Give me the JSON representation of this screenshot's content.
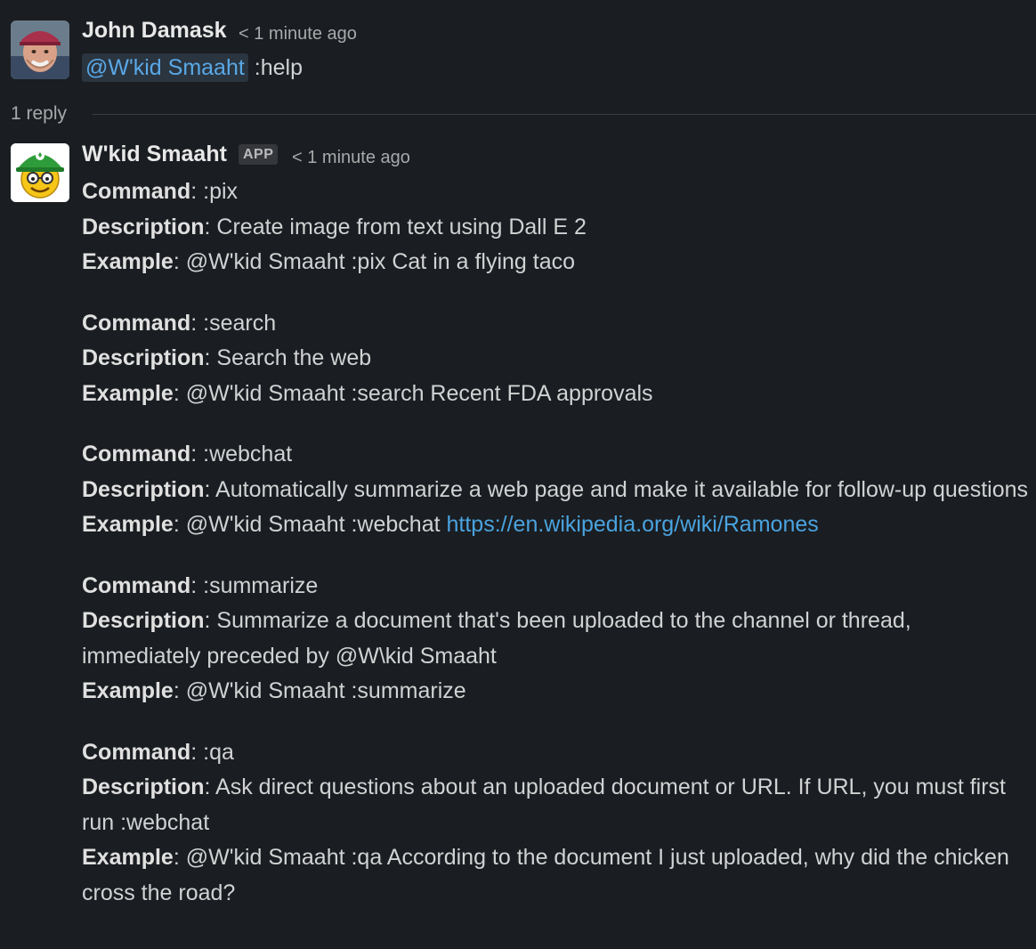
{
  "message1": {
    "author": "John Damask",
    "timestamp": "< 1 minute ago",
    "mention": "@W'kid Smaaht",
    "text": ":help"
  },
  "thread": {
    "reply_count": "1 reply"
  },
  "message2": {
    "author": "W'kid Smaaht",
    "badge": "APP",
    "timestamp": "< 1 minute ago",
    "commands": [
      {
        "command_label": "Command",
        "command": ": :pix",
        "description_label": "Description",
        "description": ": Create image from text using Dall E 2",
        "example_label": "Example",
        "example": ": @W'kid Smaaht :pix Cat in a flying taco",
        "example_link": ""
      },
      {
        "command_label": "Command",
        "command": ": :search",
        "description_label": "Description",
        "description": ": Search the web",
        "example_label": "Example",
        "example": ": @W'kid Smaaht :search Recent FDA approvals",
        "example_link": ""
      },
      {
        "command_label": "Command",
        "command": ": :webchat",
        "description_label": "Description",
        "description": ": Automatically summarize a web page and make it available for follow-up questions",
        "example_label": "Example",
        "example": ": @W'kid Smaaht :webchat ",
        "example_link": "https://en.wikipedia.org/wiki/Ramones"
      },
      {
        "command_label": "Command",
        "command": ": :summarize",
        "description_label": "Description",
        "description": ": Summarize a document that's been uploaded to the channel or thread, immediately preceded by @W\\kid Smaaht",
        "example_label": "Example",
        "example": ": @W'kid Smaaht :summarize",
        "example_link": ""
      },
      {
        "command_label": "Command",
        "command": ": :qa",
        "description_label": "Description",
        "description": ": Ask direct questions about an uploaded document or URL. If URL, you must first run :webchat",
        "example_label": "Example",
        "example": ": @W'kid Smaaht :qa According to the document I just uploaded, why did the chicken cross the road?",
        "example_link": ""
      }
    ]
  },
  "colors": {
    "background": "#1a1d21",
    "text": "#d1d2d3",
    "link": "#4aa3df",
    "mention_bg": "#2a3540"
  },
  "icons": {
    "avatar1": "user-photo-avatar",
    "avatar2": "bot-smiley-avatar"
  }
}
